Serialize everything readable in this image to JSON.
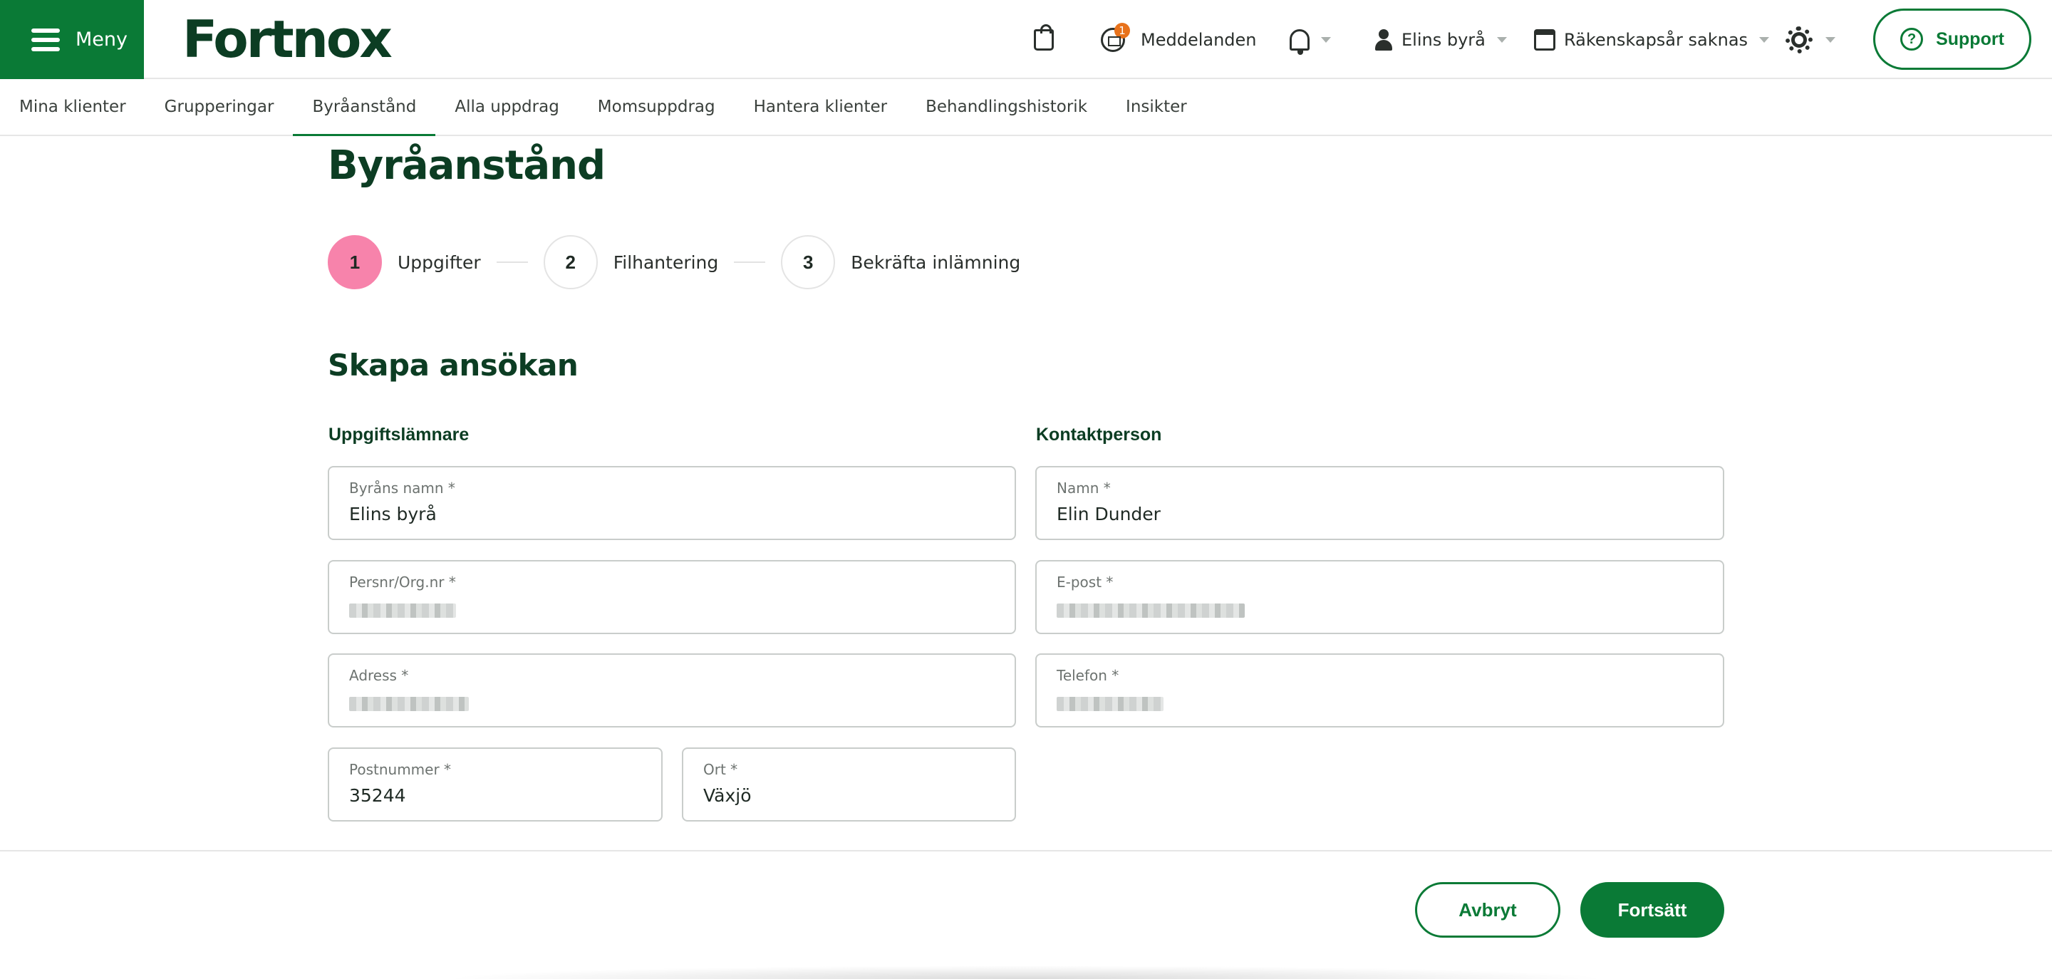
{
  "header": {
    "menu_label": "Meny",
    "logo_text": "Fortnox",
    "messages_label": "Meddelanden",
    "messages_count": "1",
    "bureau_label": "Elins byrå",
    "fiscal_year_label": "Räkenskapsår saknas",
    "support_label": "Support"
  },
  "tabs": [
    {
      "label": "Mina klienter"
    },
    {
      "label": "Grupperingar"
    },
    {
      "label": "Byråanstånd"
    },
    {
      "label": "Alla uppdrag"
    },
    {
      "label": "Momsuppdrag"
    },
    {
      "label": "Hantera klienter"
    },
    {
      "label": "Behandlingshistorik"
    },
    {
      "label": "Insikter"
    }
  ],
  "page": {
    "title": "Byråanstånd",
    "steps": [
      {
        "number": "1",
        "label": "Uppgifter"
      },
      {
        "number": "2",
        "label": "Filhantering"
      },
      {
        "number": "3",
        "label": "Bekräfta inlämning"
      }
    ],
    "section_title": "Skapa ansökan"
  },
  "form": {
    "submitter_title": "Uppgiftslämnare",
    "contact_title": "Kontaktperson",
    "bureau_name": {
      "label": "Byråns namn *",
      "value": "Elins byrå"
    },
    "org_nr": {
      "label": "Persnr/Org.nr *"
    },
    "address": {
      "label": "Adress *"
    },
    "postal_code": {
      "label": "Postnummer *",
      "value": "35244"
    },
    "city": {
      "label": "Ort *",
      "value": "Växjö"
    },
    "contact_name": {
      "label": "Namn *",
      "value": "Elin Dunder"
    },
    "email": {
      "label": "E-post *"
    },
    "phone": {
      "label": "Telefon *"
    }
  },
  "actions": {
    "cancel_label": "Avbryt",
    "continue_label": "Fortsätt"
  },
  "colors": {
    "brand_green": "#0a7a36",
    "dark_green": "#0c3d23",
    "active_step": "#f783ab",
    "notification": "#e8721b"
  }
}
